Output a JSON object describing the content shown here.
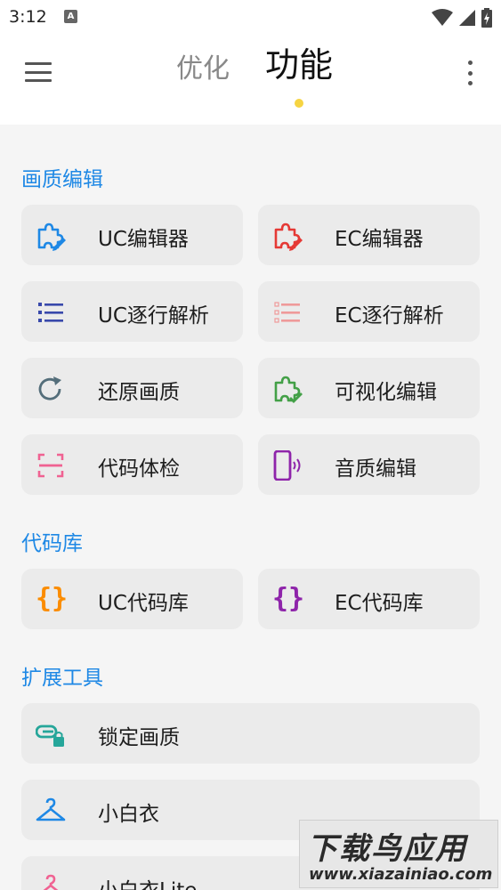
{
  "status_bar": {
    "time": "3:12",
    "notif_letter": "A"
  },
  "app_bar": {
    "tabs": [
      {
        "label": "优化",
        "active": false
      },
      {
        "label": "功能",
        "active": true
      }
    ]
  },
  "sections": [
    {
      "title": "画质编辑",
      "items": [
        {
          "label": "UC编辑器",
          "icon": "puzzle-edit-icon",
          "color": "#1e88e5"
        },
        {
          "label": "EC编辑器",
          "icon": "puzzle-edit-icon",
          "color": "#e53935"
        },
        {
          "label": "UC逐行解析",
          "icon": "list-icon",
          "color": "#3949ab"
        },
        {
          "label": "EC逐行解析",
          "icon": "list-icon",
          "color": "#ef9a9a"
        },
        {
          "label": "还原画质",
          "icon": "restore-icon",
          "color": "#546e7a"
        },
        {
          "label": "可视化编辑",
          "icon": "puzzle-check-icon",
          "color": "#43a047"
        },
        {
          "label": "代码体检",
          "icon": "scan-icon",
          "color": "#f06292"
        },
        {
          "label": "音质编辑",
          "icon": "phone-sound-icon",
          "color": "#8e24aa"
        }
      ]
    },
    {
      "title": "代码库",
      "items": [
        {
          "label": "UC代码库",
          "icon": "braces-icon",
          "color": "#fb8c00"
        },
        {
          "label": "EC代码库",
          "icon": "braces-icon",
          "color": "#8e24aa"
        }
      ]
    },
    {
      "title": "扩展工具",
      "items": [
        {
          "label": "锁定画质",
          "icon": "link-lock-icon",
          "color": "#26a69a"
        },
        {
          "label": "小白衣",
          "icon": "hanger-icon",
          "color": "#1e88e5"
        },
        {
          "label": "小白衣Lite",
          "icon": "hanger-icon",
          "color": "#f06292"
        }
      ]
    }
  ],
  "watermark": {
    "title": "下载鸟应用",
    "url": "www.xiazainiao.com"
  }
}
